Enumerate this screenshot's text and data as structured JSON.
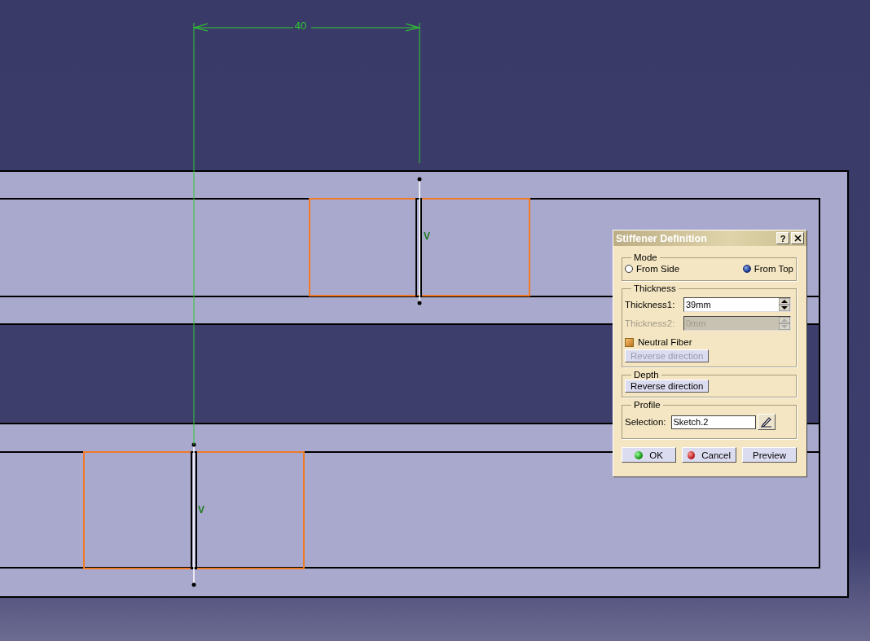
{
  "dimension": {
    "value": "40"
  },
  "constraints": [
    {
      "label": "V"
    },
    {
      "label": "V"
    }
  ],
  "dialog": {
    "title": "Stiffener Definition",
    "help": "?",
    "mode": {
      "label": "Mode",
      "options": [
        {
          "label": "From Side",
          "selected": false
        },
        {
          "label": "From Top",
          "selected": true
        }
      ]
    },
    "thickness": {
      "label": "Thickness",
      "fields": [
        {
          "label": "Thickness1:",
          "value": "39mm",
          "disabled": false
        },
        {
          "label": "Thickness2:",
          "value": "0mm",
          "disabled": true
        }
      ],
      "neutral_fiber": {
        "label": "Neutral Fiber",
        "checked": true
      },
      "reverse": {
        "label": "Reverse direction",
        "disabled": true
      }
    },
    "depth": {
      "label": "Depth",
      "reverse": {
        "label": "Reverse direction",
        "disabled": false
      }
    },
    "profile": {
      "label": "Profile",
      "selection_label": "Selection:",
      "selection": "Sketch.2"
    },
    "buttons": [
      {
        "label": "OK",
        "kind": "ok"
      },
      {
        "label": "Cancel",
        "kind": "cancel"
      },
      {
        "label": "Preview",
        "kind": "plain"
      }
    ]
  }
}
